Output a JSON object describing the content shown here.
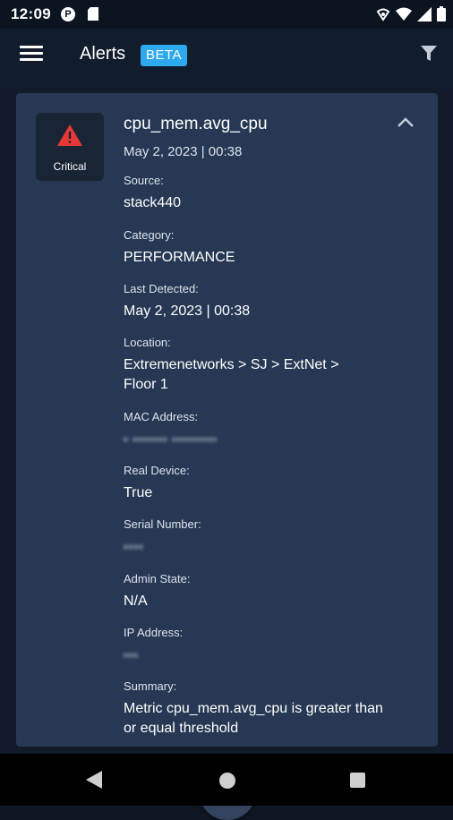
{
  "status_bar": {
    "time": "12:09",
    "p_icon_letter": "P"
  },
  "app_bar": {
    "title": "Alerts",
    "badge": "BETA"
  },
  "alert": {
    "severity": "Critical",
    "title": "cpu_mem.avg_cpu",
    "date": "May 2, 2023 | 00:38",
    "fields": [
      {
        "label": "Source:",
        "value": "stack440"
      },
      {
        "label": "Category:",
        "value": "PERFORMANCE"
      },
      {
        "label": "Last Detected:",
        "value": "May 2, 2023 | 00:38"
      },
      {
        "label": "Location:",
        "value": "Extremenetworks > SJ > ExtNet > Floor 1"
      },
      {
        "label": "MAC Address:",
        "value": ""
      },
      {
        "label": "Real Device:",
        "value": "True"
      },
      {
        "label": "Serial Number:",
        "value": ""
      },
      {
        "label": "Admin State:",
        "value": "N/A"
      },
      {
        "label": "IP Address:",
        "value": ""
      },
      {
        "label": "Summary:",
        "value": "Metric cpu_mem.avg_cpu is greater than or equal threshold"
      }
    ]
  },
  "colors": {
    "accent": "#2ea8ef",
    "critical": "#e53935",
    "card": "#263853"
  }
}
